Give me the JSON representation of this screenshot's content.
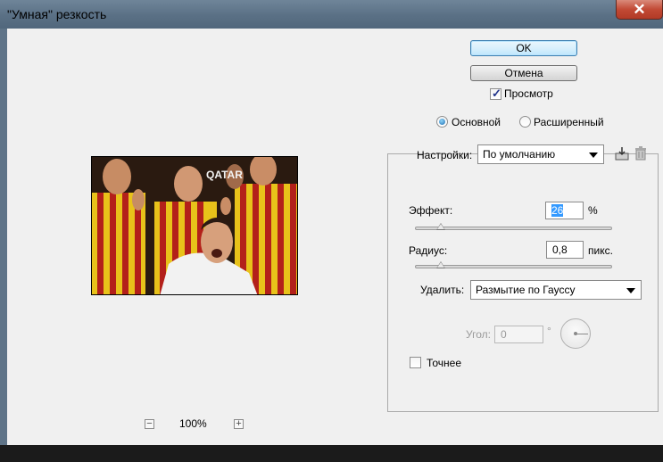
{
  "window": {
    "title": "\"Умная\" резкость",
    "close_glyph": "✕"
  },
  "buttons": {
    "ok": "OK",
    "cancel": "Отмена"
  },
  "preview_checkbox": {
    "label": "Просмотр",
    "checked": true
  },
  "mode": {
    "options": [
      {
        "label": "Основной",
        "selected": true
      },
      {
        "label": "Расширенный",
        "selected": false
      }
    ]
  },
  "settings": {
    "label": "Настройки:",
    "value": "По умолчанию",
    "save_icon": "save-preset-icon",
    "delete_icon": "trash-icon"
  },
  "amount": {
    "label": "Эффект:",
    "value": "26",
    "unit": "%",
    "slider_fraction": 0.14
  },
  "radius": {
    "label": "Радиус:",
    "value": "0,8",
    "unit": "пикс.",
    "slider_fraction": 0.13
  },
  "remove": {
    "label": "Удалить:",
    "value": "Размытие по Гауссу"
  },
  "angle": {
    "label": "Угол:",
    "value": "0",
    "unit": "°",
    "enabled": false
  },
  "more_accurate": {
    "label": "Точнее",
    "checked": false
  },
  "zoom": {
    "value": "100%",
    "minus_glyph": "−",
    "plus_glyph": "+"
  },
  "preview_image": {
    "description_icon": "preview-image",
    "jersey_text": "QATAR"
  },
  "colors": {
    "titlebar": "#5a7085",
    "dialog_bg": "#f0f0f0",
    "accent": "#3399ff",
    "close_red": "#c24a35"
  }
}
